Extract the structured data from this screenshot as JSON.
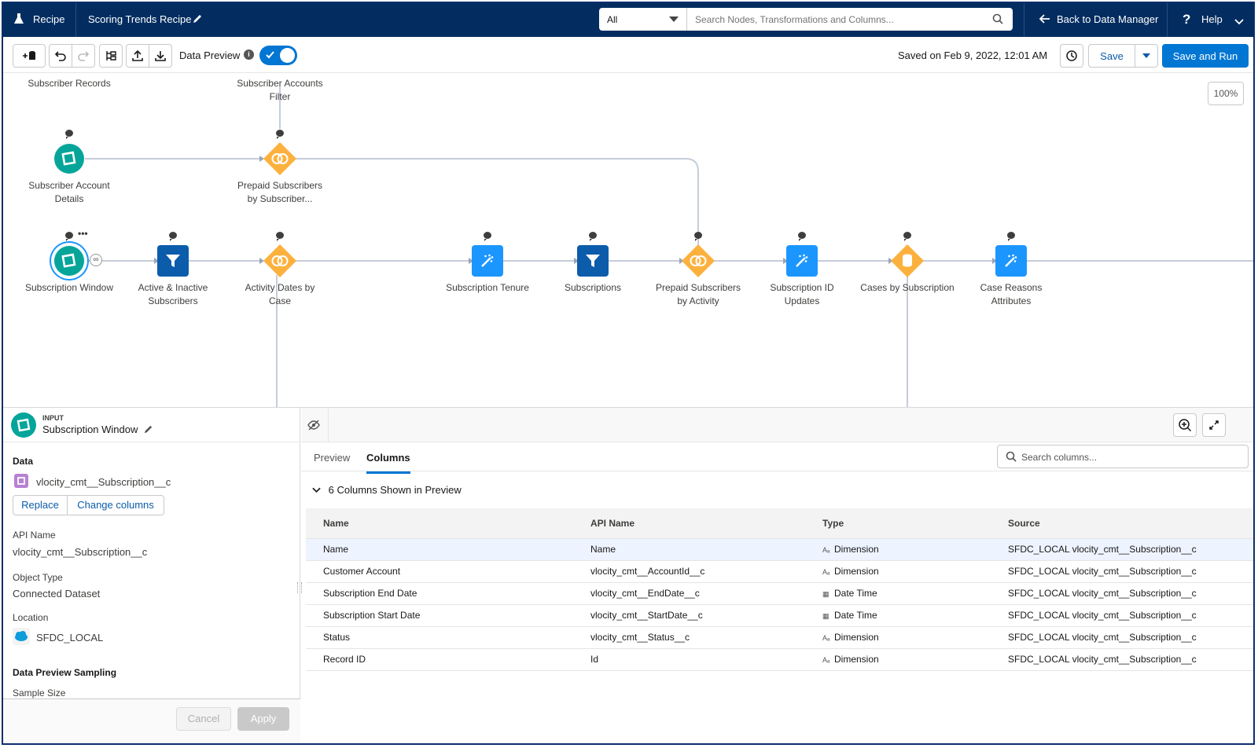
{
  "header": {
    "app_label": "Recipe",
    "recipe_title": "Scoring Trends Recipe",
    "scope_value": "All",
    "search_placeholder": "Search Nodes, Transformations and Columns...",
    "back_label": "Back to Data Manager",
    "help_label": "Help"
  },
  "toolbar": {
    "data_preview_label": "Data Preview",
    "data_preview_on": true,
    "saved_text": "Saved on Feb 9, 2022, 12:01 AM",
    "save_label": "Save",
    "save_run_label": "Save and Run",
    "zoom": "100%"
  },
  "canvas": {
    "top_labels": {
      "subscriber_records": "Subscriber Records",
      "accounts_filter": "Subscriber Accounts Filter"
    },
    "nodes": [
      {
        "id": "n1",
        "label": "Subscriber Account Details",
        "kind": "input",
        "icon": "dataset-icon"
      },
      {
        "id": "n2",
        "label": "Prepaid Subscribers by Subscriber...",
        "kind": "join",
        "icon": "join-icon"
      },
      {
        "id": "n3",
        "label": "Subscription Window",
        "kind": "input",
        "icon": "dataset-icon",
        "selected": true
      },
      {
        "id": "n4",
        "label": "Active & Inactive Subscribers",
        "kind": "filter",
        "icon": "filter-icon"
      },
      {
        "id": "n5",
        "label": "Activity Dates by Case",
        "kind": "join",
        "icon": "join-icon"
      },
      {
        "id": "n6",
        "label": "Subscription Tenure",
        "kind": "transform",
        "icon": "transform-icon"
      },
      {
        "id": "n7",
        "label": "Subscriptions",
        "kind": "filter",
        "icon": "filter-icon"
      },
      {
        "id": "n8",
        "label": "Prepaid Subscribers by Activity",
        "kind": "join",
        "icon": "join-icon"
      },
      {
        "id": "n9",
        "label": "Subscription ID Updates",
        "kind": "transform",
        "icon": "transform-icon"
      },
      {
        "id": "n10",
        "label": "Cases by Subscription",
        "kind": "aggregate",
        "icon": "aggregate-icon"
      },
      {
        "id": "n11",
        "label": "Case Reasons Attributes",
        "kind": "transform",
        "icon": "transform-icon"
      }
    ]
  },
  "left_panel": {
    "kind_label": "INPUT",
    "node_name": "Subscription Window",
    "data_heading": "Data",
    "object_name": "vlocity_cmt__Subscription__c",
    "replace_label": "Replace",
    "change_columns_label": "Change columns",
    "api_name_label": "API Name",
    "api_name_value": "vlocity_cmt__Subscription__c",
    "object_type_label": "Object Type",
    "object_type_value": "Connected Dataset",
    "location_label": "Location",
    "location_value": "SFDC_LOCAL",
    "sampling_heading": "Data Preview Sampling",
    "sample_size_label": "Sample Size",
    "cancel_label": "Cancel",
    "apply_label": "Apply"
  },
  "right_panel": {
    "tabs": [
      {
        "label": "Preview"
      },
      {
        "label": "Columns",
        "active": true
      }
    ],
    "search_placeholder": "Search columns...",
    "section_title": "6 Columns Shown in Preview",
    "columns": [
      "Name",
      "API Name",
      "Type",
      "Source"
    ],
    "rows": [
      {
        "name": "Name",
        "api": "Name",
        "type_icon": "text-type-icon",
        "type": "Dimension",
        "source": "SFDC_LOCAL vlocity_cmt__Subscription__c",
        "selected": true
      },
      {
        "name": "Customer Account",
        "api": "vlocity_cmt__AccountId__c",
        "type_icon": "text-type-icon",
        "type": "Dimension",
        "source": "SFDC_LOCAL vlocity_cmt__Subscription__c"
      },
      {
        "name": "Subscription End Date",
        "api": "vlocity_cmt__EndDate__c",
        "type_icon": "calendar-type-icon",
        "type": "Date Time",
        "source": "SFDC_LOCAL vlocity_cmt__Subscription__c"
      },
      {
        "name": "Subscription Start Date",
        "api": "vlocity_cmt__StartDate__c",
        "type_icon": "calendar-type-icon",
        "type": "Date Time",
        "source": "SFDC_LOCAL vlocity_cmt__Subscription__c"
      },
      {
        "name": "Status",
        "api": "vlocity_cmt__Status__c",
        "type_icon": "text-type-icon",
        "type": "Dimension",
        "source": "SFDC_LOCAL vlocity_cmt__Subscription__c"
      },
      {
        "name": "Record ID",
        "api": "Id",
        "type_icon": "text-type-icon",
        "type": "Dimension",
        "source": "SFDC_LOCAL vlocity_cmt__Subscription__c"
      }
    ]
  },
  "colors": {
    "header_bg": "#032d60",
    "brand": "#0176d3",
    "input_node": "#06a59a",
    "join_node": "#fcb13e",
    "transform_node": "#1b96ff",
    "filter_node": "#0b5cab"
  }
}
